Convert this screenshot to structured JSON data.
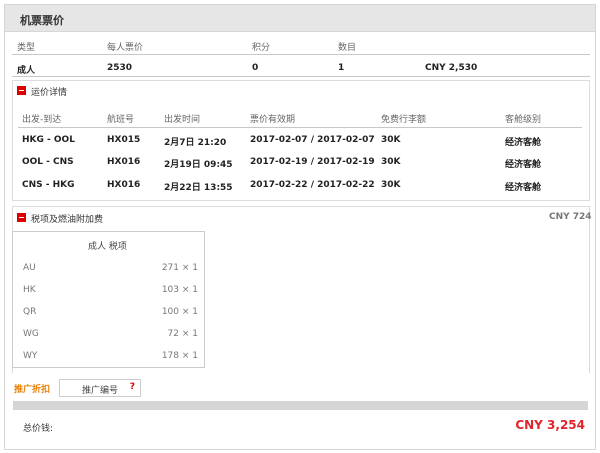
{
  "header": {
    "title": "机票票价"
  },
  "summary": {
    "col_type": "类型",
    "col_price": "每人票价",
    "col_points": "积分",
    "col_count": "数目",
    "type": "成人",
    "price": "2530",
    "points": "0",
    "count": "1",
    "subtotal": "CNY 2,530"
  },
  "fare_details": {
    "title": "运价详情",
    "headers": [
      "出发-到达",
      "航班号",
      "出发时间",
      "票价有效期",
      "免费行李额",
      "客舱级别"
    ],
    "rows": [
      {
        "route": "HKG - OOL",
        "flight": "HX015",
        "depart": "2月7日 21:20",
        "validity": "2017-02-07 / 2017-02-07",
        "baggage": "30K",
        "cabin": "经济客舱"
      },
      {
        "route": "OOL - CNS",
        "flight": "HX016",
        "depart": "2月19日 09:45",
        "validity": "2017-02-19 / 2017-02-19",
        "baggage": "30K",
        "cabin": "经济客舱"
      },
      {
        "route": "CNS - HKG",
        "flight": "HX016",
        "depart": "2月22日 13:55",
        "validity": "2017-02-22 / 2017-02-22",
        "baggage": "30K",
        "cabin": "经济客舱"
      }
    ]
  },
  "taxes": {
    "title": "税项及燃油附加费",
    "total": "CNY 724",
    "table_title": "成人 税项",
    "rows": [
      {
        "code": "AU",
        "amount": "271 × 1"
      },
      {
        "code": "HK",
        "amount": "103 × 1"
      },
      {
        "code": "QR",
        "amount": "100 × 1"
      },
      {
        "code": "WG",
        "amount": "72 × 1"
      },
      {
        "code": "WY",
        "amount": "178 × 1"
      }
    ]
  },
  "promo": {
    "label": "推广折扣",
    "placeholder": "推广编号",
    "help": "?"
  },
  "total": {
    "label": "总价钱:",
    "value": "CNY 3,254"
  },
  "colors": {
    "accent_red": "#e0242c",
    "promo_orange": "#e8830c",
    "header_grey": "#e6e6e6"
  }
}
